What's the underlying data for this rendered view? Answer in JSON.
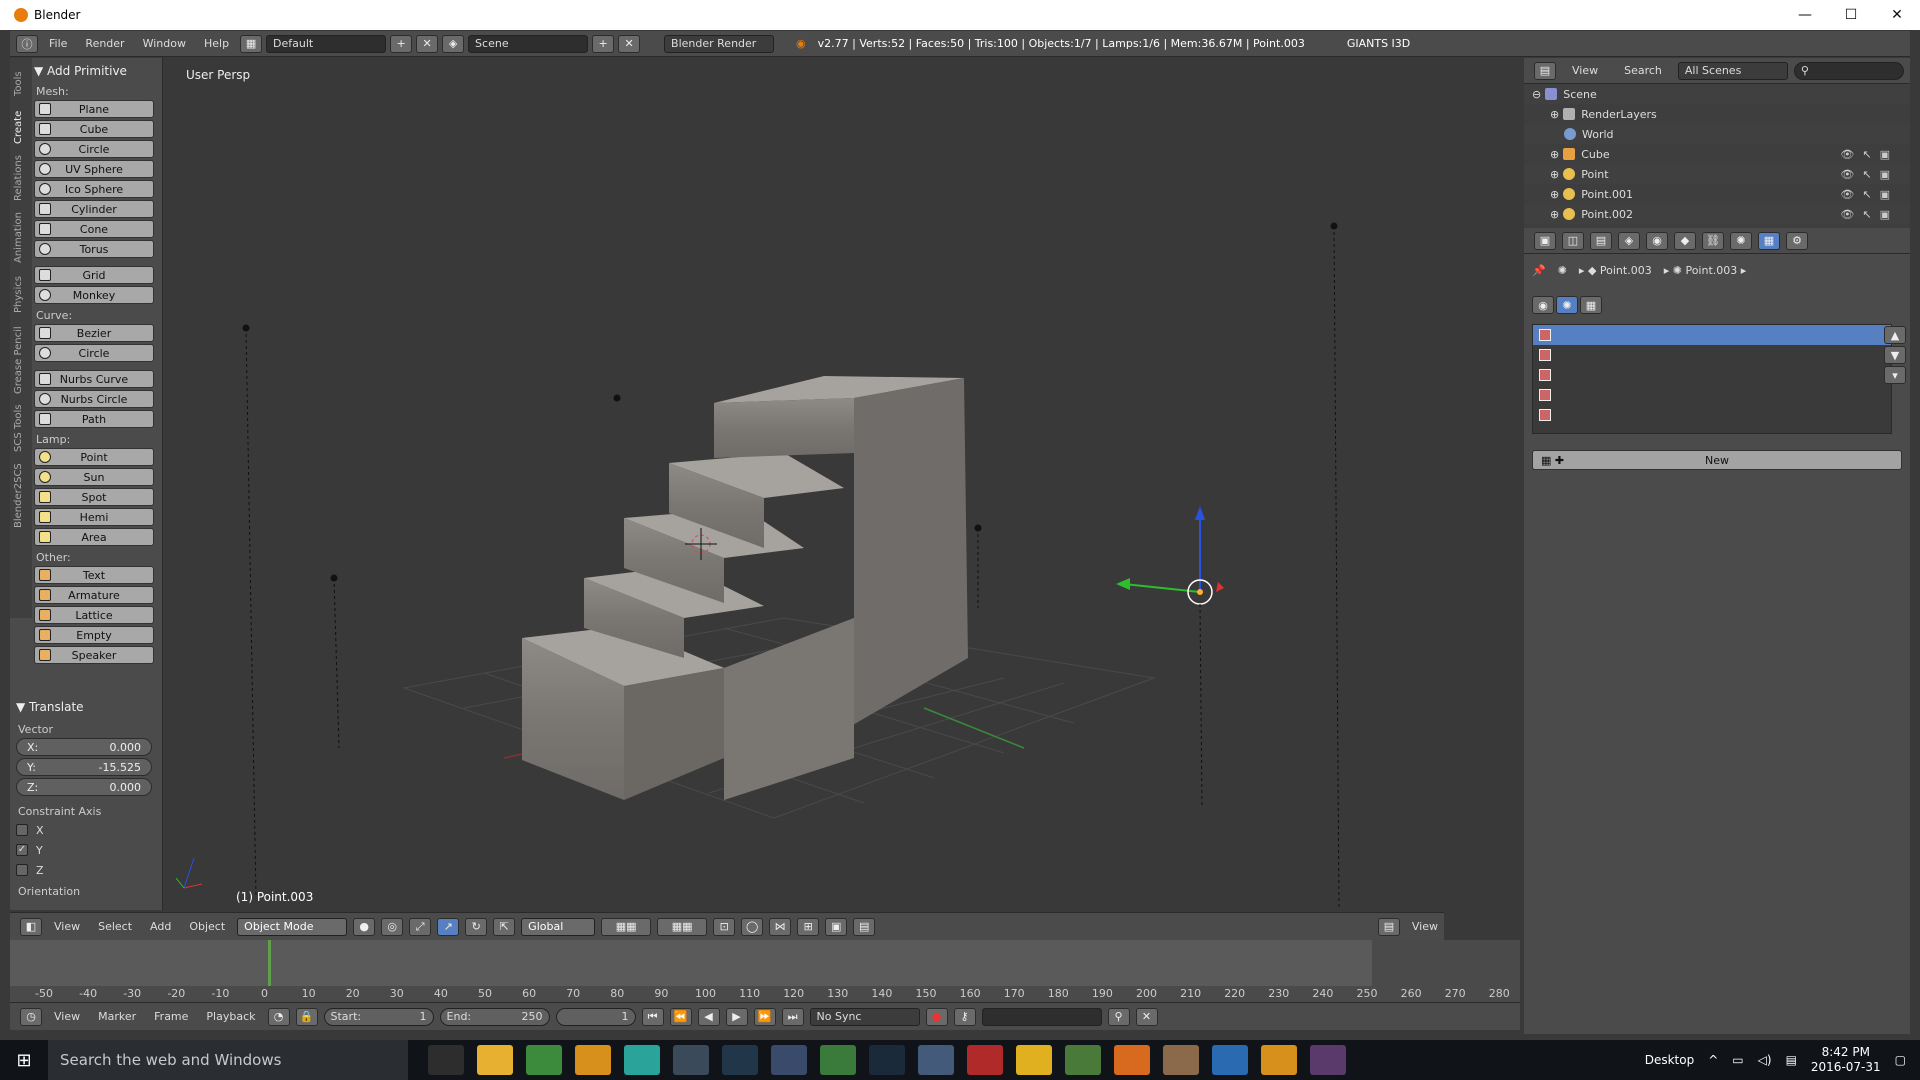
{
  "window": {
    "title": "Blender",
    "minimize": "—",
    "maximize": "☐",
    "close": "✕"
  },
  "topbar": {
    "menus": [
      "File",
      "Render",
      "Window",
      "Help"
    ],
    "layout": "Default",
    "scene": "Scene",
    "engine": "Blender Render",
    "info": "v2.77 | Verts:52 | Faces:50 | Tris:100 | Objects:1/7 | Lamps:1/6 | Mem:36.67M | Point.003",
    "addon": "GIANTS I3D"
  },
  "toolshelf": {
    "tabs": [
      "Tools",
      "Create",
      "Relations",
      "Animation",
      "Physics",
      "Grease Pencil",
      "SCS Tools",
      "Blender2SCS"
    ],
    "add_primitive_title": "Add Primitive",
    "mesh_label": "Mesh:",
    "mesh": [
      "Plane",
      "Cube",
      "Circle",
      "UV Sphere",
      "Ico Sphere",
      "Cylinder",
      "Cone",
      "Torus"
    ],
    "mesh2": [
      "Grid",
      "Monkey"
    ],
    "curve_label": "Curve:",
    "curve": [
      "Bezier",
      "Circle"
    ],
    "curve2": [
      "Nurbs Curve",
      "Nurbs Circle",
      "Path"
    ],
    "lamp_label": "Lamp:",
    "lamp": [
      "Point",
      "Sun",
      "Spot",
      "Hemi",
      "Area"
    ],
    "other_label": "Other:",
    "other": [
      "Text",
      "Armature",
      "Lattice",
      "Empty",
      "Speaker"
    ],
    "translate_title": "Translate",
    "vector_label": "Vector",
    "x": {
      "label": "X:",
      "value": "0.000"
    },
    "y": {
      "label": "Y:",
      "value": "-15.525"
    },
    "z": {
      "label": "Z:",
      "value": "0.000"
    },
    "constraint_label": "Constraint Axis",
    "constraint": [
      {
        "label": "X",
        "checked": false
      },
      {
        "label": "Y",
        "checked": true
      },
      {
        "label": "Z",
        "checked": false
      }
    ],
    "orientation_label": "Orientation"
  },
  "viewport": {
    "label": "User Persp",
    "object": "(1) Point.003"
  },
  "header3d": {
    "menus": [
      "View",
      "Select",
      "Add",
      "Object"
    ],
    "mode": "Object Mode",
    "orientation": "Global",
    "view_right": "View"
  },
  "timeline": {
    "ticks": [
      "-50",
      "-40",
      "-30",
      "-20",
      "-10",
      "0",
      "10",
      "20",
      "30",
      "40",
      "50",
      "60",
      "70",
      "80",
      "90",
      "100",
      "110",
      "120",
      "130",
      "140",
      "150",
      "160",
      "170",
      "180",
      "190",
      "200",
      "210",
      "220",
      "230",
      "240",
      "250",
      "260",
      "270",
      "280"
    ],
    "current_frame": 1,
    "menus": [
      "View",
      "Marker",
      "Frame",
      "Playback"
    ],
    "start_label": "Start:",
    "start_value": "1",
    "end_label": "End:",
    "end_value": "250",
    "frame_value": "1",
    "sync": "No Sync"
  },
  "outliner": {
    "menus": [
      "View",
      "Search"
    ],
    "filter": "All Scenes",
    "rows": [
      {
        "name": "Scene",
        "color": "#8a8fd0"
      },
      {
        "name": "RenderLayers",
        "color": "#b0b0b0"
      },
      {
        "name": "World",
        "color": "#7a9bd1"
      },
      {
        "name": "Cube",
        "color": "#e8a040"
      },
      {
        "name": "Point",
        "color": "#e8c050"
      },
      {
        "name": "Point.001",
        "color": "#e8c050"
      },
      {
        "name": "Point.002",
        "color": "#e8c050"
      }
    ]
  },
  "properties": {
    "crumb1": "Point.003",
    "crumb2": "Point.003",
    "new_label": "New"
  },
  "taskbar": {
    "search_placeholder": "Search the web and Windows",
    "desktop": "Desktop",
    "time": "8:42 PM",
    "date": "2016-07-31"
  }
}
